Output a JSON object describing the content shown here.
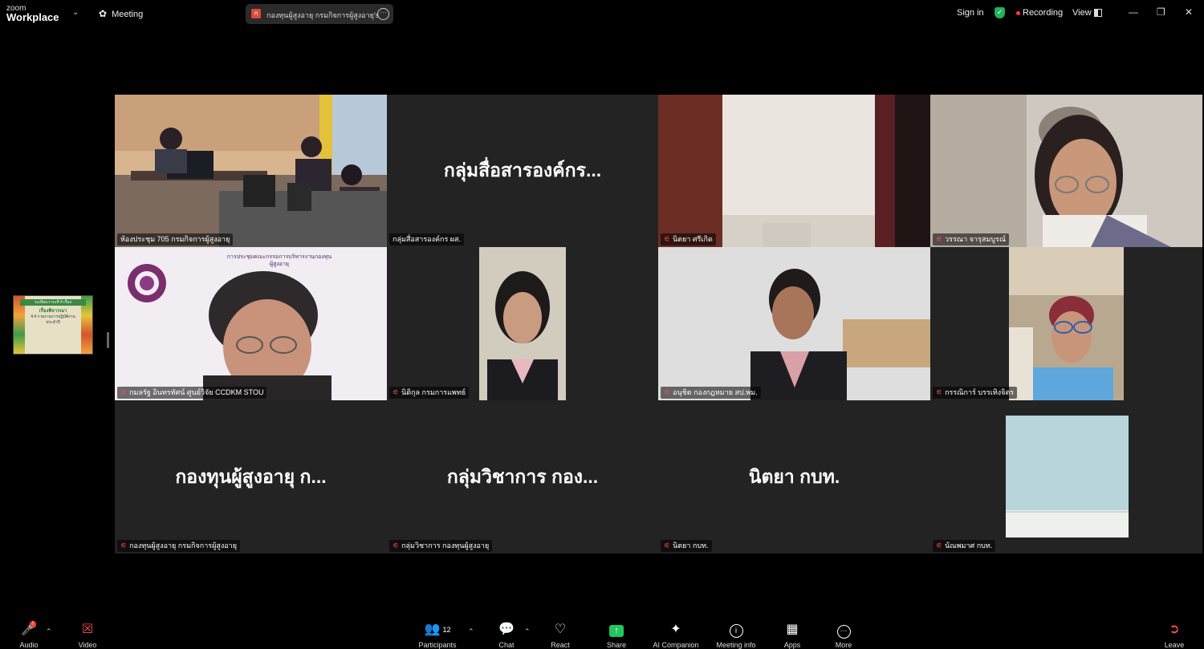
{
  "app": {
    "logo_line1": "zoom",
    "logo_line2": "Workplace",
    "meeting_label": "Meeting",
    "tab_title": "กองทุนผู้สูงอายุ กรมกิจการผู้สูงอายุ's sc",
    "tab_badge": "ก",
    "sign_in": "Sign in",
    "recording": "Recording",
    "view": "View"
  },
  "tiles": [
    {
      "name": "ห้องประชุม 705 กรมกิจการผู้สูงอายุ",
      "muted": false,
      "active": true
    },
    {
      "name": "กลุ่มสื่อสารองค์กร ผส.",
      "big": "กลุ่มสื่อสารองค์กร...",
      "muted": false
    },
    {
      "name": "นิตยา ศรีเกิด",
      "muted": true
    },
    {
      "name": "วรรณา จารุสมบูรณ์",
      "muted": true
    },
    {
      "name": "กมลรัฐ อินทรทัศน์ ศูนย์วิจัย CCDKM STOU",
      "muted": true
    },
    {
      "name": "นิติกุล กรมการแพทย์",
      "muted": true
    },
    {
      "name": "อนุชิต กองกฎหมาย สป.พม.",
      "muted": true
    },
    {
      "name": "กรรณิการ์ บรรเทิงจิตร",
      "muted": true
    },
    {
      "name": "กองทุนผู้สูงอายุ กรมกิจการผู้สูงอายุ",
      "big": "กองทุนผู้สูงอายุ ก...",
      "muted": true
    },
    {
      "name": "กลุ่มวิชาการ กองทุนผู้สูงอายุ",
      "big": "กลุ่มวิชาการ กอง...",
      "muted": true
    },
    {
      "name": "นิตยา กบท.",
      "big": "นิตยา กบท.",
      "muted": true
    },
    {
      "name": "น้ณพมาศ กบท.",
      "muted": true
    }
  ],
  "shared_content": {
    "header": "ระเบียบวาระที่ 4 เรื่อง",
    "title": "เรื่องพิจารณา",
    "body": "4.4 รายงานการปฏิบัติงานประจำปี"
  },
  "slide_overlay": {
    "line1": "การประชุมคณะกรรมการบริหารงานกองทุน",
    "line2": "ผู้สูงอายุ"
  },
  "toolbar": {
    "audio": "Audio",
    "video": "Video",
    "participants": "Participants",
    "participants_count": "12",
    "chat": "Chat",
    "react": "React",
    "share": "Share",
    "ai_companion": "AI Companion",
    "meeting_info": "Meeting info",
    "apps": "Apps",
    "more": "More",
    "leave": "Leave",
    "audio_badge": "!"
  },
  "colors": {
    "active_speaker": "#23d18b",
    "share_green": "#22c55e",
    "recording_dot": "#ff3b30",
    "tile_bg": "#232323",
    "muted_red": "#ff4d4d"
  }
}
